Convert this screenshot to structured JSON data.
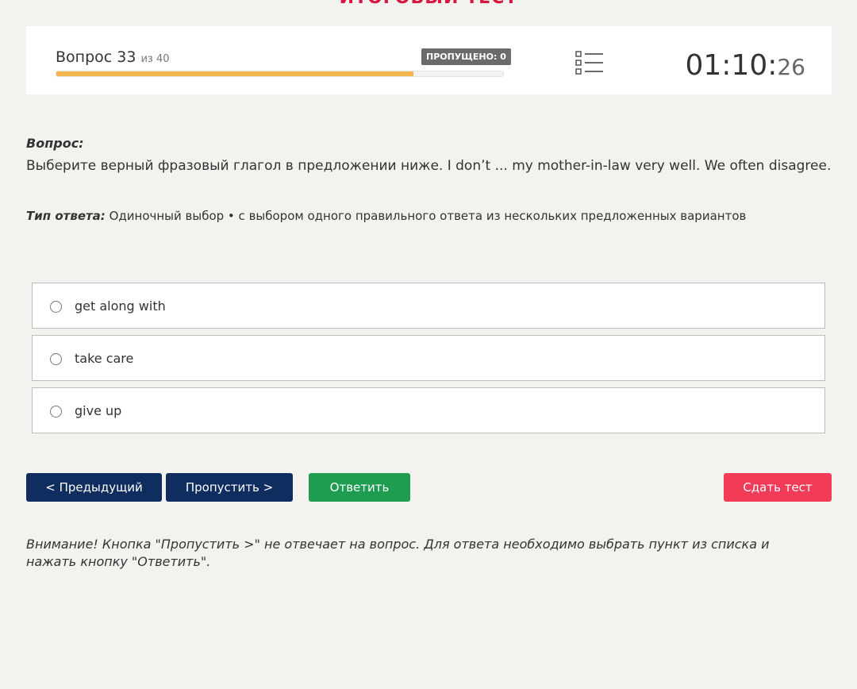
{
  "page": {
    "title": "ИТОГОВЫЙ ТЕСТ"
  },
  "status": {
    "question_label": "Вопрос 33",
    "question_of": "из 40",
    "skipped_badge": "ПРОПУЩЕНО: 0",
    "progress_percent": 80,
    "timer_main": "01:10:",
    "timer_seconds": "26",
    "progress_color": "#f2b64a"
  },
  "question": {
    "label": "Вопрос:",
    "text": "Выберите верный фразовый глагол в предложении ниже. I don’t ... my mother-in-law very well. We often disagree.",
    "answer_type_label": "Тип ответа:",
    "answer_type_value": "Одиночный выбор • с выбором одного правильного ответа из нескольких предложенных вариантов"
  },
  "options": [
    {
      "label": "get along with"
    },
    {
      "label": "take care"
    },
    {
      "label": "give up"
    }
  ],
  "buttons": {
    "prev": "< Предыдущий",
    "skip": "Пропустить >",
    "answer": "Ответить",
    "submit": "Сдать тест"
  },
  "notice": "Внимание! Кнопка \"Пропустить >\" не отвечает на вопрос. Для ответа необходимо выбрать пункт из списка и нажать кнопку \"Ответить\".",
  "icons": {
    "question_list": "list-icon"
  },
  "colors": {
    "title": "#d6173f",
    "primary": "#0f2d5e",
    "success": "#1e9c50",
    "danger": "#f23b56"
  }
}
